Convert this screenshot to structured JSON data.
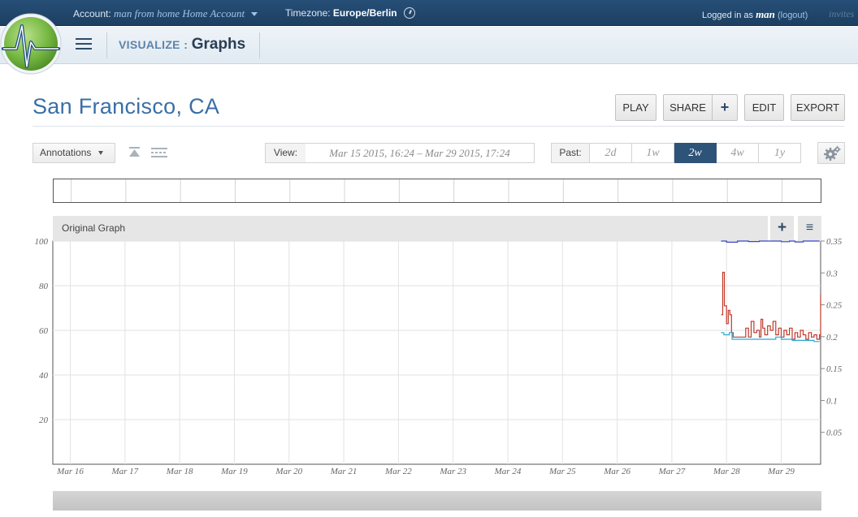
{
  "topbar": {
    "account_label": "Account:",
    "account_value": "man from home Home Account",
    "timezone_label": "Timezone:",
    "timezone_value": "Europe/Berlin",
    "logged_in_prefix": "Logged in as",
    "user": "man",
    "logout": "(logout)",
    "invites": "invites"
  },
  "nav": {
    "section": "VISUALIZE",
    "separator": ":",
    "page": "Graphs"
  },
  "page_title": "San Francisco, CA",
  "toolbar": {
    "play": "PLAY",
    "share": "SHARE",
    "add": "+",
    "edit": "EDIT",
    "export": "EXPORT"
  },
  "controls": {
    "annotations": "Annotations",
    "view_label": "View:",
    "view_value": "Mar 15 2015, 16:24  –  Mar 29 2015, 17:24",
    "past_label": "Past:",
    "ranges": [
      "2d",
      "1w",
      "2w",
      "4w",
      "1y"
    ],
    "active_range": "2w"
  },
  "panel": {
    "title": "Original Graph",
    "add": "+",
    "menu": "≡"
  },
  "colors": {
    "accent": "#2e5379",
    "title": "#3a6fa6",
    "red_series": "#c0392b",
    "cyan_series": "#29a8d6",
    "blue_series": "#3b45c4"
  },
  "chart_data": {
    "type": "line",
    "x_ticks": [
      "Mar 16",
      "Mar 17",
      "Mar 18",
      "Mar 19",
      "Mar 20",
      "Mar 21",
      "Mar 22",
      "Mar 23",
      "Mar 24",
      "Mar 25",
      "Mar 26",
      "Mar 27",
      "Mar 28",
      "Mar 29"
    ],
    "x_range_days": [
      15.68,
      29.72
    ],
    "y_left": {
      "ticks": [
        "100",
        "80",
        "60",
        "40",
        "20"
      ],
      "range": [
        0,
        100
      ]
    },
    "y_right": {
      "ticks": [
        "0.35",
        "0.3",
        "0.25",
        "0.2",
        "0.15",
        "0.1",
        "0.05"
      ],
      "range": [
        0,
        0.35
      ]
    },
    "grid": true,
    "series": [
      {
        "color": "#3b45c4",
        "axis": "left",
        "x": [
          27.9,
          28.0,
          28.2,
          28.4,
          28.6,
          28.8,
          29.0,
          29.15,
          29.25,
          29.4,
          29.55,
          29.7
        ],
        "y": [
          100,
          99.5,
          100,
          99.8,
          100,
          100,
          99.7,
          100,
          99.6,
          100,
          100,
          100
        ]
      },
      {
        "color": "#c0392b",
        "axis": "left",
        "x": [
          27.9,
          27.93,
          27.96,
          28.0,
          28.03,
          28.06,
          28.09,
          28.12,
          28.2,
          28.3,
          28.35,
          28.4,
          28.45,
          28.5,
          28.55,
          28.6,
          28.63,
          28.66,
          28.7,
          28.75,
          28.8,
          28.85,
          28.9,
          28.95,
          29.0,
          29.05,
          29.1,
          29.15,
          29.2,
          29.25,
          29.3,
          29.35,
          29.4,
          29.45,
          29.5,
          29.55,
          29.6,
          29.65,
          29.7,
          29.72
        ],
        "y": [
          67,
          86,
          71,
          63,
          69,
          67,
          59,
          57,
          57,
          57,
          61,
          57,
          64,
          59,
          60,
          57,
          65,
          61,
          58,
          62,
          60,
          64,
          58,
          61,
          57,
          60,
          58,
          61,
          56,
          59,
          57,
          60,
          58,
          56,
          59,
          57,
          58,
          56,
          58,
          76
        ]
      },
      {
        "color": "#29a8d6",
        "axis": "left",
        "x": [
          27.9,
          27.95,
          28.0,
          28.05,
          28.1,
          28.2,
          28.3,
          28.4,
          28.5,
          28.6,
          28.7,
          28.8,
          28.9,
          29.0,
          29.1,
          29.2,
          29.3,
          29.4,
          29.5,
          29.6,
          29.7
        ],
        "y": [
          59,
          58,
          58,
          59,
          56,
          56,
          56,
          56,
          56,
          56,
          56,
          56,
          57,
          56,
          56,
          55.5,
          55.5,
          55.5,
          55.5,
          55,
          55
        ]
      }
    ]
  }
}
